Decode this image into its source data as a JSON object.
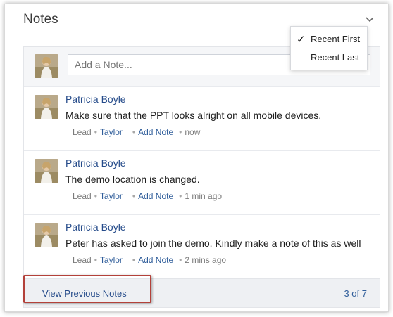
{
  "header": {
    "title": "Notes"
  },
  "compose": {
    "placeholder": "Add a Note..."
  },
  "sort_menu": {
    "items": [
      {
        "label": "Recent First",
        "selected": true
      },
      {
        "label": "Recent Last",
        "selected": false
      }
    ]
  },
  "notes": [
    {
      "author": "Patricia Boyle",
      "text": "Make sure that the PPT looks alright on all mobile devices.",
      "type": "Lead",
      "record": "Taylor",
      "action": "Add Note",
      "time": "now"
    },
    {
      "author": "Patricia Boyle",
      "text": "The demo location is changed.",
      "type": "Lead",
      "record": "Taylor",
      "action": "Add Note",
      "time": "1 min ago"
    },
    {
      "author": "Patricia Boyle",
      "text": "Peter has asked to join the demo. Kindly make a note of this as well",
      "type": "Lead",
      "record": "Taylor",
      "action": "Add Note",
      "time": "2 mins ago"
    }
  ],
  "footer": {
    "view_previous": "View Previous Notes",
    "count": "3 of 7"
  },
  "colors": {
    "link": "#254b8a",
    "highlight_border": "#b3413a",
    "panel_bg": "#f5f6f8"
  }
}
